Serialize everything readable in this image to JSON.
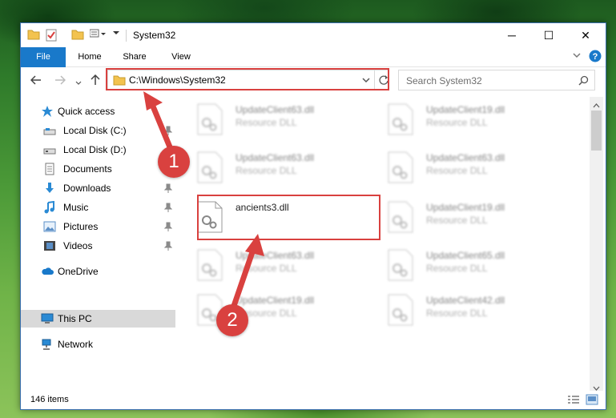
{
  "window": {
    "title": "System32",
    "minimize_glyph": "─",
    "maximize_glyph": "☐",
    "close_glyph": "✕"
  },
  "ribbon": {
    "tabs": [
      "File",
      "Home",
      "Share",
      "View"
    ]
  },
  "navbar": {
    "address": "C:\\Windows\\System32",
    "search_placeholder": "Search System32"
  },
  "sidebar": {
    "items": [
      {
        "label": "Quick access",
        "icon": "star-icon",
        "pinned": false
      },
      {
        "label": "Local Disk (C:)",
        "icon": "drive-icon",
        "pinned": true
      },
      {
        "label": "Local Disk (D:)",
        "icon": "drive-icon",
        "pinned": false
      },
      {
        "label": "Documents",
        "icon": "documents-icon",
        "pinned": true
      },
      {
        "label": "Downloads",
        "icon": "download-icon",
        "pinned": true
      },
      {
        "label": "Music",
        "icon": "music-icon",
        "pinned": true
      },
      {
        "label": "Pictures",
        "icon": "pictures-icon",
        "pinned": true
      },
      {
        "label": "Videos",
        "icon": "videos-icon",
        "pinned": true
      },
      {
        "label": "OneDrive",
        "icon": "cloud-icon",
        "pinned": false
      },
      {
        "label": "This PC",
        "icon": "computer-icon",
        "pinned": false
      },
      {
        "label": "Network",
        "icon": "network-icon",
        "pinned": false
      }
    ]
  },
  "files": [
    {
      "name": "UpdateClient63.dll",
      "type": "Resource DLL"
    },
    {
      "name": "UpdateClient19.dll",
      "type": "Resource DLL"
    },
    {
      "name": "UpdateClient63.dll",
      "type": "Resource DLL"
    },
    {
      "name": "UpdateClient63.dll",
      "type": "Resource DLL"
    },
    {
      "name": "ancients3.dll",
      "type": ""
    },
    {
      "name": "UpdateClient19.dll",
      "type": "Resource DLL"
    },
    {
      "name": "UpdateClient63.dll",
      "type": "Resource DLL"
    },
    {
      "name": "UpdateClient65.dll",
      "type": "Resource DLL"
    },
    {
      "name": "UpdateClient19.dll",
      "type": "Resource DLL"
    },
    {
      "name": "UpdateClient42.dll",
      "type": "Resource DLL"
    }
  ],
  "annotations": {
    "step1": "1",
    "step2": "2",
    "highlight_color": "#d9413f"
  },
  "status": {
    "item_count": "146 items"
  },
  "colors": {
    "accent": "#1979ca",
    "selection": "#d9d9d9"
  }
}
